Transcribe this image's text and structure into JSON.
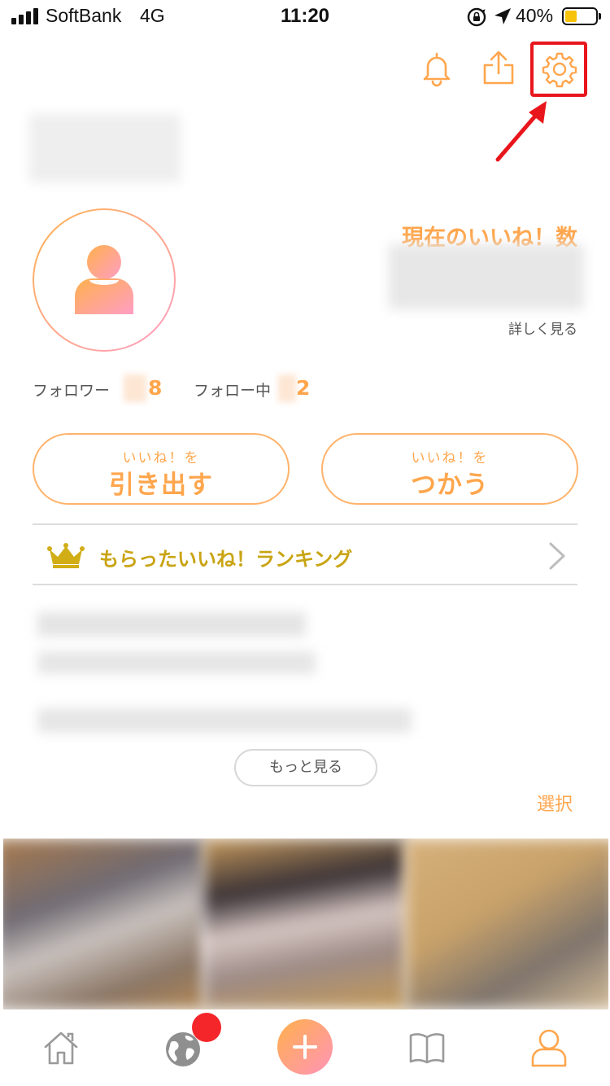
{
  "status_bar": {
    "carrier": "SoftBank",
    "network": "4G",
    "time": "11:20",
    "battery_percent": "40%",
    "battery_level": 0.4,
    "battery_color": "#f6c20a"
  },
  "header": {
    "icons": [
      "bell-icon",
      "share-icon",
      "gear-icon"
    ]
  },
  "profile": {
    "likes_label": "現在のいいね！数",
    "detail_link": "詳しく見る",
    "followers_label": "フォロワー",
    "followers_count": "8",
    "following_label": "フォロー中",
    "following_count": "2"
  },
  "actions": {
    "withdraw": {
      "sub": "いいね！を",
      "main": "引き出す"
    },
    "use": {
      "sub": "いいね！を",
      "main": "つかう"
    }
  },
  "ranking": {
    "label": "もらったいいね！ランキング"
  },
  "more_button": "もっと見る",
  "select_link": "選択",
  "colors": {
    "accent": "#ffa64d",
    "ranking_gold": "#c9a413",
    "highlight_red": "#e8161c",
    "badge_red": "#f4262a"
  },
  "tab_bar": {
    "items": [
      "home-icon",
      "globe-icon",
      "plus-icon",
      "book-icon",
      "profile-icon"
    ]
  }
}
